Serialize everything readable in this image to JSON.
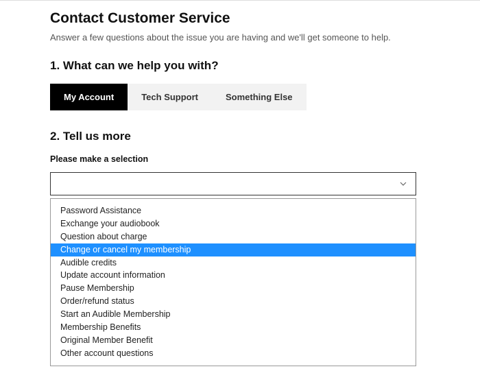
{
  "header": {
    "title": "Contact Customer Service",
    "subtitle": "Answer a few questions about the issue you are having and we'll get someone to help."
  },
  "step1": {
    "heading": "1. What can we help you with?",
    "tabs": [
      {
        "label": "My Account",
        "active": true
      },
      {
        "label": "Tech Support",
        "active": false
      },
      {
        "label": "Something Else",
        "active": false
      }
    ]
  },
  "step2": {
    "heading": "2. Tell us more",
    "select_label": "Please make a selection",
    "options": [
      {
        "label": "Password Assistance",
        "highlighted": false
      },
      {
        "label": "Exchange your audiobook",
        "highlighted": false
      },
      {
        "label": "Question about charge",
        "highlighted": false
      },
      {
        "label": "Change or cancel my membership",
        "highlighted": true
      },
      {
        "label": "Audible credits",
        "highlighted": false
      },
      {
        "label": "Update account information",
        "highlighted": false
      },
      {
        "label": "Pause Membership",
        "highlighted": false
      },
      {
        "label": "Order/refund status",
        "highlighted": false
      },
      {
        "label": "Start an Audible Membership",
        "highlighted": false
      },
      {
        "label": "Membership Benefits",
        "highlighted": false
      },
      {
        "label": "Original Member Benefit",
        "highlighted": false
      },
      {
        "label": "Other account questions",
        "highlighted": false
      }
    ]
  }
}
